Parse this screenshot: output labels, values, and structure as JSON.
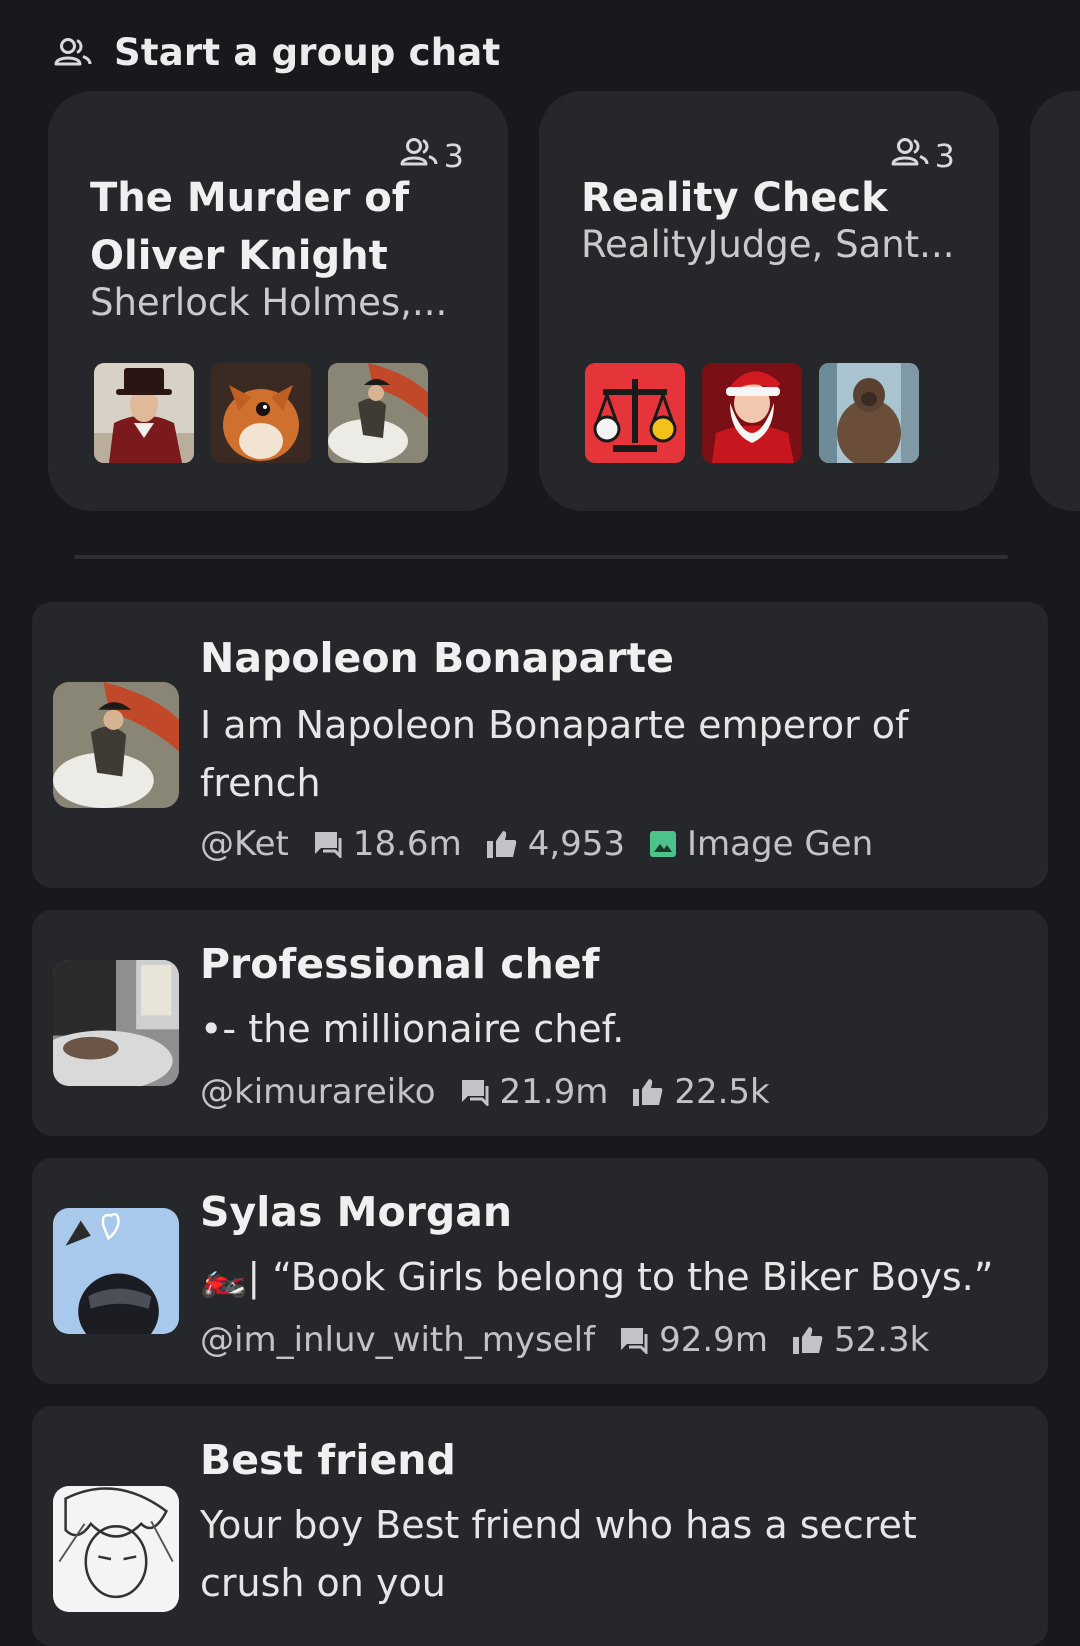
{
  "group_chats": {
    "header": "Start a group chat",
    "icon": "people-outline-icon",
    "cards": [
      {
        "title": "The Murder of Oliver Knight",
        "members": "Sherlock Holmes,...",
        "count": "3",
        "avatars": [
          "sherlock-holmes-avatar",
          "squirrel-avatar",
          "napoleon-avatar"
        ]
      },
      {
        "title": "Reality Check",
        "members": "RealityJudge, Sant...",
        "count": "3",
        "avatars": [
          "scales-avatar",
          "santa-avatar",
          "bigfoot-avatar"
        ]
      }
    ]
  },
  "characters": [
    {
      "name": "Napoleon Bonaparte",
      "description": "I am Napoleon Bonaparte emperor of french",
      "handle": "@Ket",
      "chats": "18.6m",
      "likes": "4,953",
      "badge": "Image Gen",
      "badge_color": "#4cc38a"
    },
    {
      "name": "Professional chef",
      "description": "•- the millionaire chef.",
      "handle": "@kimurareiko",
      "chats": "21.9m",
      "likes": "22.5k"
    },
    {
      "name": "Sylas Morgan",
      "description": "🏍️| “Book Girls belong to the Biker Boys.”",
      "handle": "@im_inluv_with_myself",
      "chats": "92.9m",
      "likes": "52.3k"
    },
    {
      "name": "Best friend",
      "description": "Your boy Best friend who has a secret crush on you"
    }
  ],
  "colors": {
    "background": "#18191c",
    "card": "#25272b",
    "text_primary": "#f0f0f1",
    "text_secondary": "#c2c3c6"
  }
}
